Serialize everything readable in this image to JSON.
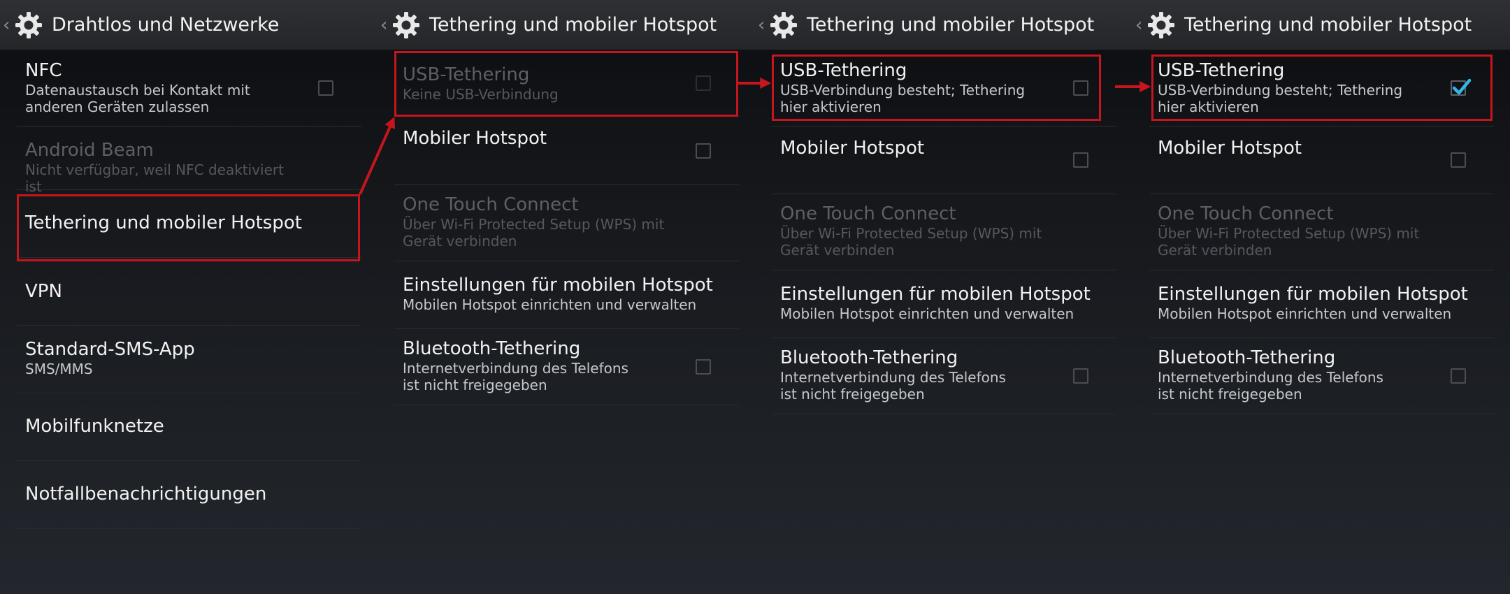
{
  "colors": {
    "highlight": "#c4161c",
    "check": "#33b5e5"
  },
  "panel1": {
    "title": "Drahtlos und Netzwerke",
    "items": [
      {
        "title": "NFC",
        "summary": "Datenaustausch bei Kontakt mit anderen Geräten zulassen"
      },
      {
        "title": "Android Beam",
        "summary": "Nicht verfügbar, weil NFC deaktiviert ist"
      },
      {
        "title": "Tethering und mobiler Hotspot"
      },
      {
        "title": "VPN"
      },
      {
        "title": "Standard-SMS-App",
        "summary": "SMS/MMS"
      },
      {
        "title": "Mobilfunknetze"
      },
      {
        "title": "Notfallbenachrichtigungen"
      }
    ]
  },
  "panel2": {
    "title": "Tethering und mobiler Hotspot",
    "items": [
      {
        "title": "USB-Tethering",
        "summary": "Keine USB-Verbindung"
      },
      {
        "title": "Mobiler Hotspot"
      },
      {
        "title": "One Touch Connect",
        "summary": "Über Wi-Fi Protected Setup (WPS) mit Gerät verbinden"
      },
      {
        "title": "Einstellungen für mobilen Hotspot",
        "summary": "Mobilen Hotspot einrichten und verwalten"
      },
      {
        "title": "Bluetooth-Tethering",
        "summary": "Internetverbindung des Telefons ist nicht freigegeben"
      }
    ]
  },
  "panel3": {
    "title": "Tethering und mobiler Hotspot",
    "items": [
      {
        "title": "USB-Tethering",
        "summary": "USB-Verbindung besteht; Tethering hier aktivieren"
      },
      {
        "title": "Mobiler Hotspot"
      },
      {
        "title": "One Touch Connect",
        "summary": "Über Wi-Fi Protected Setup (WPS) mit Gerät verbinden"
      },
      {
        "title": "Einstellungen für mobilen Hotspot",
        "summary": "Mobilen Hotspot einrichten und verwalten"
      },
      {
        "title": "Bluetooth-Tethering",
        "summary": "Internetverbindung des Telefons ist nicht freigegeben"
      }
    ]
  },
  "panel4": {
    "title": "Tethering und mobiler Hotspot",
    "items": [
      {
        "title": "USB-Tethering",
        "summary": "USB-Verbindung besteht; Tethering hier aktivieren",
        "checked": true
      },
      {
        "title": "Mobiler Hotspot"
      },
      {
        "title": "One Touch Connect",
        "summary": "Über Wi-Fi Protected Setup (WPS) mit Gerät verbinden"
      },
      {
        "title": "Einstellungen für mobilen Hotspot",
        "summary": "Mobilen Hotspot einrichten und verwalten"
      },
      {
        "title": "Bluetooth-Tethering",
        "summary": "Internetverbindung des Telefons ist nicht freigegeben"
      }
    ]
  }
}
